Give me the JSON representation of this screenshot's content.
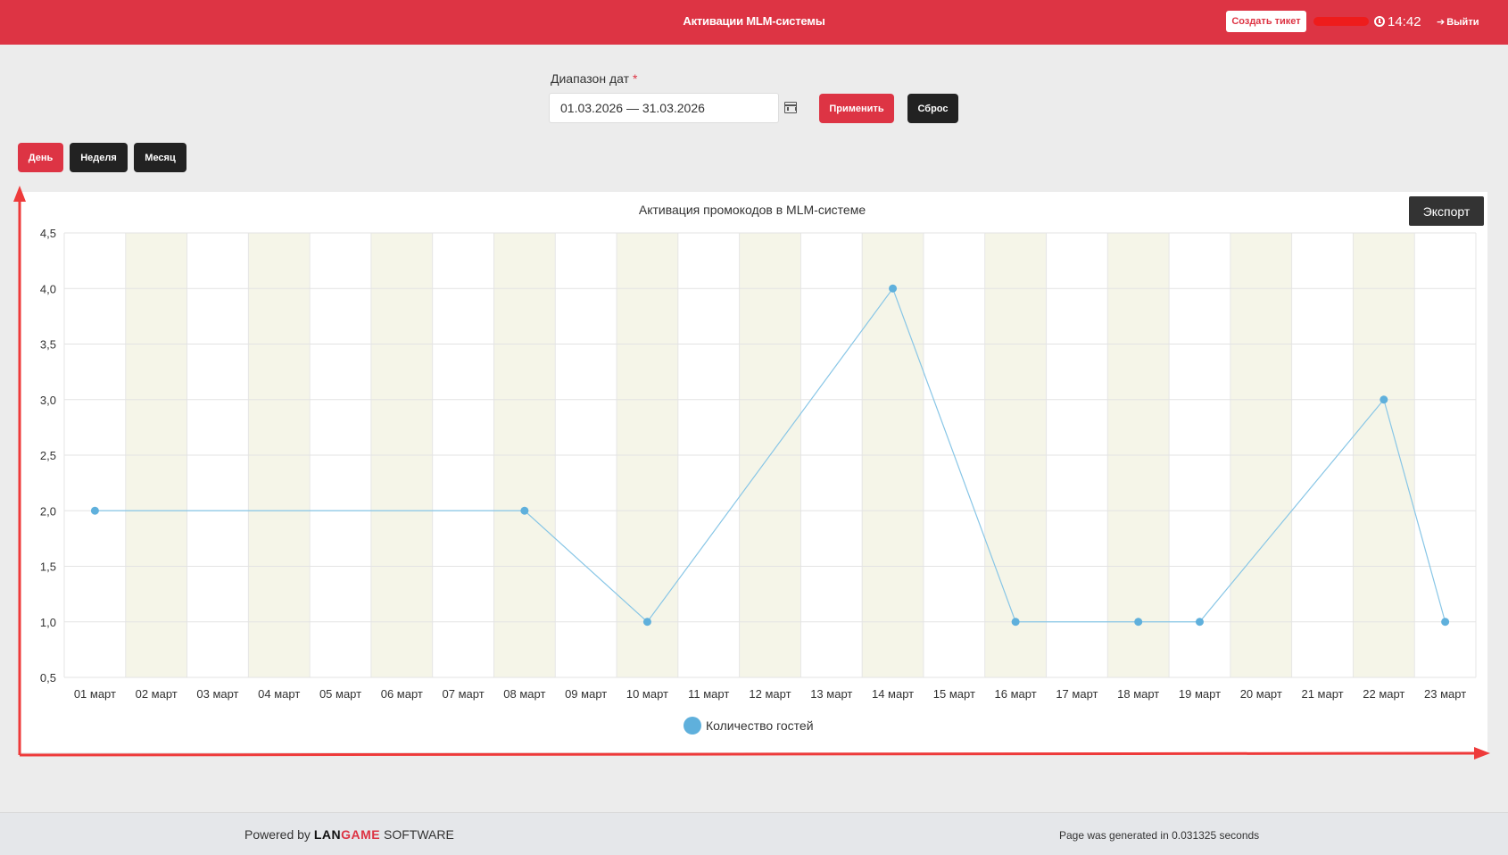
{
  "header": {
    "title": "Активации MLM-системы",
    "ticket_button": "Создать тикет",
    "time": "14:42",
    "logout": "Выйти"
  },
  "filter": {
    "label": "Диапазон дат",
    "required_mark": "*",
    "date_range_value": "01.03.2026 — 31.03.2026",
    "apply_button": "Применить",
    "reset_button": "Сброс"
  },
  "period_buttons": {
    "day": "День",
    "week": "Неделя",
    "month": "Месяц"
  },
  "export_button": "Экспорт",
  "chart_data": {
    "type": "line",
    "title": "Активация промокодов в MLM-системе",
    "categories": [
      "01 март",
      "02 март",
      "03 март",
      "04 март",
      "05 март",
      "06 март",
      "07 март",
      "08 март",
      "09 март",
      "10 март",
      "11 март",
      "12 март",
      "13 март",
      "14 март",
      "15 март",
      "16 март",
      "17 март",
      "18 март",
      "19 март",
      "20 март",
      "21 март",
      "22 март",
      "23 март"
    ],
    "yticks": [
      "4,5",
      "4,0",
      "3,5",
      "3,0",
      "2,5",
      "2,0",
      "1,5",
      "1,0",
      "0,5"
    ],
    "ylim": [
      0.5,
      4.5
    ],
    "grid": true,
    "legend_position": "bottom",
    "series": [
      {
        "name": "Количество гостей",
        "color": "#5fb0dc",
        "points": [
          {
            "x": "01 март",
            "y": 2
          },
          {
            "x": "08 март",
            "y": 2
          },
          {
            "x": "10 март",
            "y": 1
          },
          {
            "x": "14 март",
            "y": 4
          },
          {
            "x": "16 март",
            "y": 1
          },
          {
            "x": "18 март",
            "y": 1
          },
          {
            "x": "19 март",
            "y": 1
          },
          {
            "x": "22 март",
            "y": 3
          },
          {
            "x": "23 март",
            "y": 1
          }
        ]
      }
    ],
    "alt_band_color": "#f5f5e8"
  },
  "footer": {
    "powered_prefix": "Powered by",
    "brand_part1": "LAN",
    "brand_part2": "GAME",
    "brand_suffix": "SOFTWARE",
    "generated_text": "Page was generated in 0.031325 seconds"
  }
}
